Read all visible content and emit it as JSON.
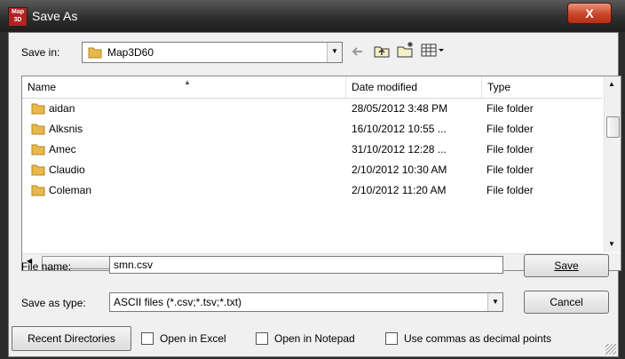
{
  "window": {
    "title": "Save As",
    "icon_label": "Map 3D",
    "close_glyph": "X"
  },
  "toolbar": {
    "save_in_label": "Save in:",
    "location": "Map3D60",
    "back_icon": "back-arrow-icon",
    "up_icon": "up-folder-icon",
    "new_folder_icon": "new-folder-icon",
    "view_icon": "view-menu-icon"
  },
  "list": {
    "columns": [
      "Name",
      "Date modified",
      "Type"
    ],
    "rows": [
      {
        "name": "aidan",
        "date": "28/05/2012 3:48 PM",
        "type": "File folder"
      },
      {
        "name": "Alksnis",
        "date": "16/10/2012 10:55 ...",
        "type": "File folder"
      },
      {
        "name": "Amec",
        "date": "31/10/2012 12:28 ...",
        "type": "File folder"
      },
      {
        "name": "Claudio",
        "date": "2/10/2012 10:30 AM",
        "type": "File folder"
      },
      {
        "name": "Coleman",
        "date": "2/10/2012 11:20 AM",
        "type": "File folder"
      }
    ]
  },
  "form": {
    "file_name_label": "File name:",
    "file_name_value": "smn.csv",
    "save_as_type_label": "Save as type:",
    "save_as_type_value": "ASCII files (*.csv;*.tsv;*.txt)",
    "save_button": "Save",
    "cancel_button": "Cancel"
  },
  "footer": {
    "recent_button": "Recent Directories",
    "open_excel": "Open in Excel",
    "open_notepad": "Open in Notepad",
    "use_commas": "Use commas as decimal points"
  },
  "colors": {
    "folder": "#e8b84a",
    "titlebar": "#2e2e2e",
    "close": "#c9452a"
  }
}
